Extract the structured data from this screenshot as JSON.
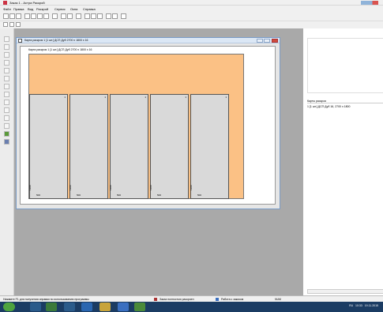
{
  "app": {
    "title": "Заказ 1 - Астра Раскрой"
  },
  "menu": {
    "items": [
      "Файл",
      "Правка",
      "Вид",
      "Раскрой",
      "Сервис",
      "Окна",
      "Справка"
    ]
  },
  "child_window": {
    "title": "Карта раскроя 1 [1 шт.] ДСП Дуб 2700 x 1800 x 16",
    "map_label": "Карта раскроя 1 [1 шт.] ДСП Дуб 2700 x 1800 x 16",
    "panels": [
      {
        "id": "1",
        "width": "500",
        "height": "1300"
      },
      {
        "id": "1",
        "width": "500",
        "height": "1300"
      },
      {
        "id": "1",
        "width": "500",
        "height": "1300"
      },
      {
        "id": "1",
        "width": "500",
        "height": "1300"
      },
      {
        "id": "1",
        "width": "500",
        "height": "1300"
      }
    ]
  },
  "right_panel": {
    "header": "Карты раскроя",
    "items": [
      "1 [1 шт.] ДСП Дуб 16, 2700 x 1800"
    ]
  },
  "status": {
    "hint": "Нажмите F1 для получения справки по использованию программы",
    "orders": "Заказ полностью раскроен",
    "work": "Работа с заказом",
    "num": "NUM"
  },
  "taskbar": {
    "lang": "RU",
    "time": "10:33",
    "date": "19.11.2015"
  },
  "colors": {
    "sheet": "#fbc185",
    "panel": "#d9d9d9",
    "workspace": "#a9a9a9"
  }
}
